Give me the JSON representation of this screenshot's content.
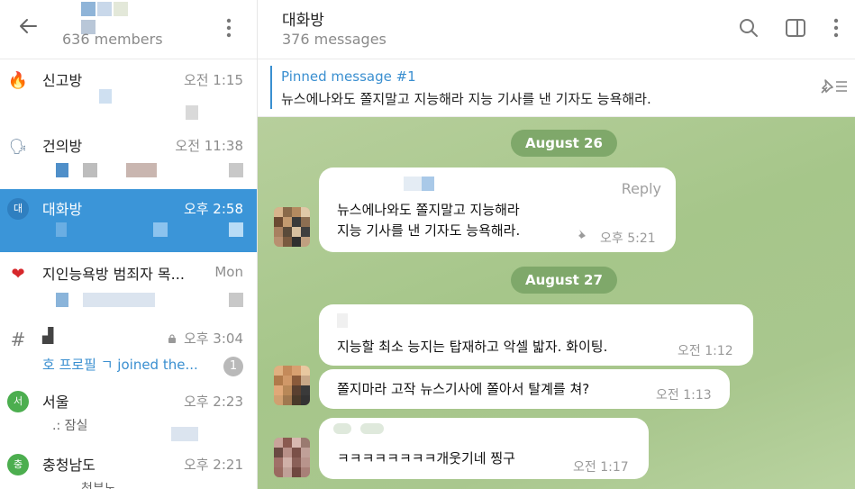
{
  "sidebar": {
    "members_label": "636 members",
    "chats": [
      {
        "icon": "🔥",
        "name": "신고방",
        "time": "오전 1:15"
      },
      {
        "icon": "🗣",
        "name": "건의방",
        "time": "오전 11:38"
      },
      {
        "icon": "대",
        "name": "대화방",
        "time": "오후 2:58"
      },
      {
        "icon": "❤",
        "name": "지인능욕방 범죄자 목...",
        "time": "Mon"
      },
      {
        "icon": "#",
        "name": "▟",
        "time": "오후 3:04",
        "preview": "호 프로필 ㄱ joined the...",
        "badge": "1"
      },
      {
        "icon": "서",
        "name": "서울",
        "time": "오후 2:23",
        "preview": ".: 잠실"
      },
      {
        "icon": "충",
        "name": "충청남도",
        "time": "오후 2:21",
        "preview": "청부노"
      }
    ]
  },
  "header": {
    "title": "대화방",
    "subtitle": "376 messages"
  },
  "pinned": {
    "title": "Pinned message #1",
    "text": "뉴스에나와도 쫄지말고 지능해라  지능 기사를 낸 기자도 능욕해라."
  },
  "messages": {
    "date1": "August 26",
    "date2": "August 27",
    "reply_label": "Reply",
    "m1_line1": "뉴스에나와도 쫄지말고 지능해라",
    "m1_line2": "지능 기사를 낸 기자도 능욕해라.",
    "m1_time": "오후 5:21",
    "m2_text": "지능할 최소 능지는 탑재하고 악셀 밟자. 화이팅.",
    "m2_time": "오전 1:12",
    "m3_text": "쫄지마라 고작 뉴스기사에 쫄아서 탈계를 쳐?",
    "m3_time": "오전 1:13",
    "m4_text": "ㅋㅋㅋㅋㅋㅋㅋㅋ개웃기네 찡구",
    "m4_time": "오전 1:17"
  },
  "colors": {
    "accent": "#3a8fd0",
    "active_row": "#3b95d8",
    "date_pill": "#7fa86a"
  },
  "icons": [
    "back-arrow-icon",
    "more-vertical-icon",
    "search-icon",
    "sidebar-panel-icon",
    "unpin-list-icon",
    "pin-icon",
    "lock-icon"
  ]
}
